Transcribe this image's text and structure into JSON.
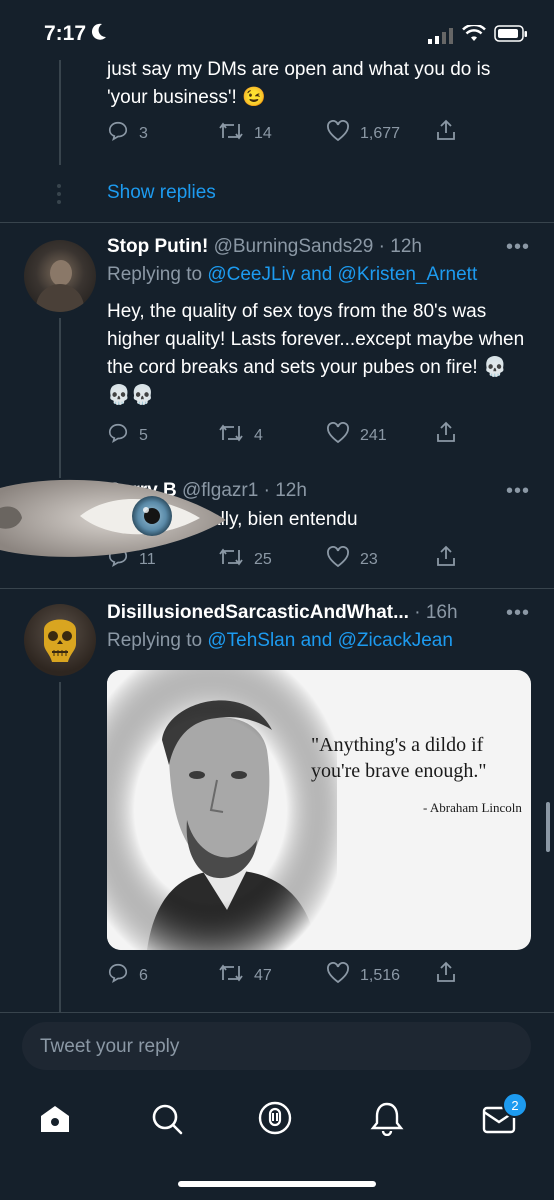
{
  "status_bar": {
    "time": "7:17"
  },
  "tweet_top": {
    "text": "just say my DMs are open and what you do is 'your business'! 😉",
    "actions": {
      "replies": "3",
      "retweets": "14",
      "likes": "1,677"
    },
    "show_replies": "Show replies"
  },
  "tweet_putin": {
    "display_name": "Stop Putin!",
    "handle": "@BurningSands29",
    "time": "· 12h",
    "replying_to": "Replying to",
    "mention1": "@CeeJLiv",
    "and": "and",
    "mention2": "@Kristen_Arnett",
    "text": "Hey, the quality of sex toys from the 80's was higher quality! Lasts forever...except maybe when the cord breaks and sets your pubes on fire! 💀💀💀",
    "actions": {
      "replies": "5",
      "retweets": "4",
      "likes": "241"
    }
  },
  "tweet_gerry": {
    "display_name": "Gerry B",
    "handle": "@flgazr1",
    "time": "· 12h",
    "text": "ally, bien entendu",
    "actions": {
      "replies": "11",
      "retweets": "25",
      "likes": "23"
    }
  },
  "tweet_disillusioned": {
    "display_name": "DisillusionedSarcasticAndWhat...",
    "time": "· 16h",
    "replying_to": "Replying to",
    "mention1": "@TehSlan",
    "and": "and",
    "mention2": "@ZicackJean",
    "image": {
      "quote": "\"Anything's a dildo if you're brave enough.\"",
      "attribution": "- Abraham Lincoln"
    },
    "actions": {
      "replies": "6",
      "retweets": "47",
      "likes": "1,516"
    }
  },
  "reply_box": {
    "placeholder": "Tweet your reply"
  },
  "nav": {
    "messages_badge": "2"
  },
  "colors": {
    "background": "#15202b",
    "accent": "#1d9bf0",
    "muted": "#8b98a5"
  }
}
